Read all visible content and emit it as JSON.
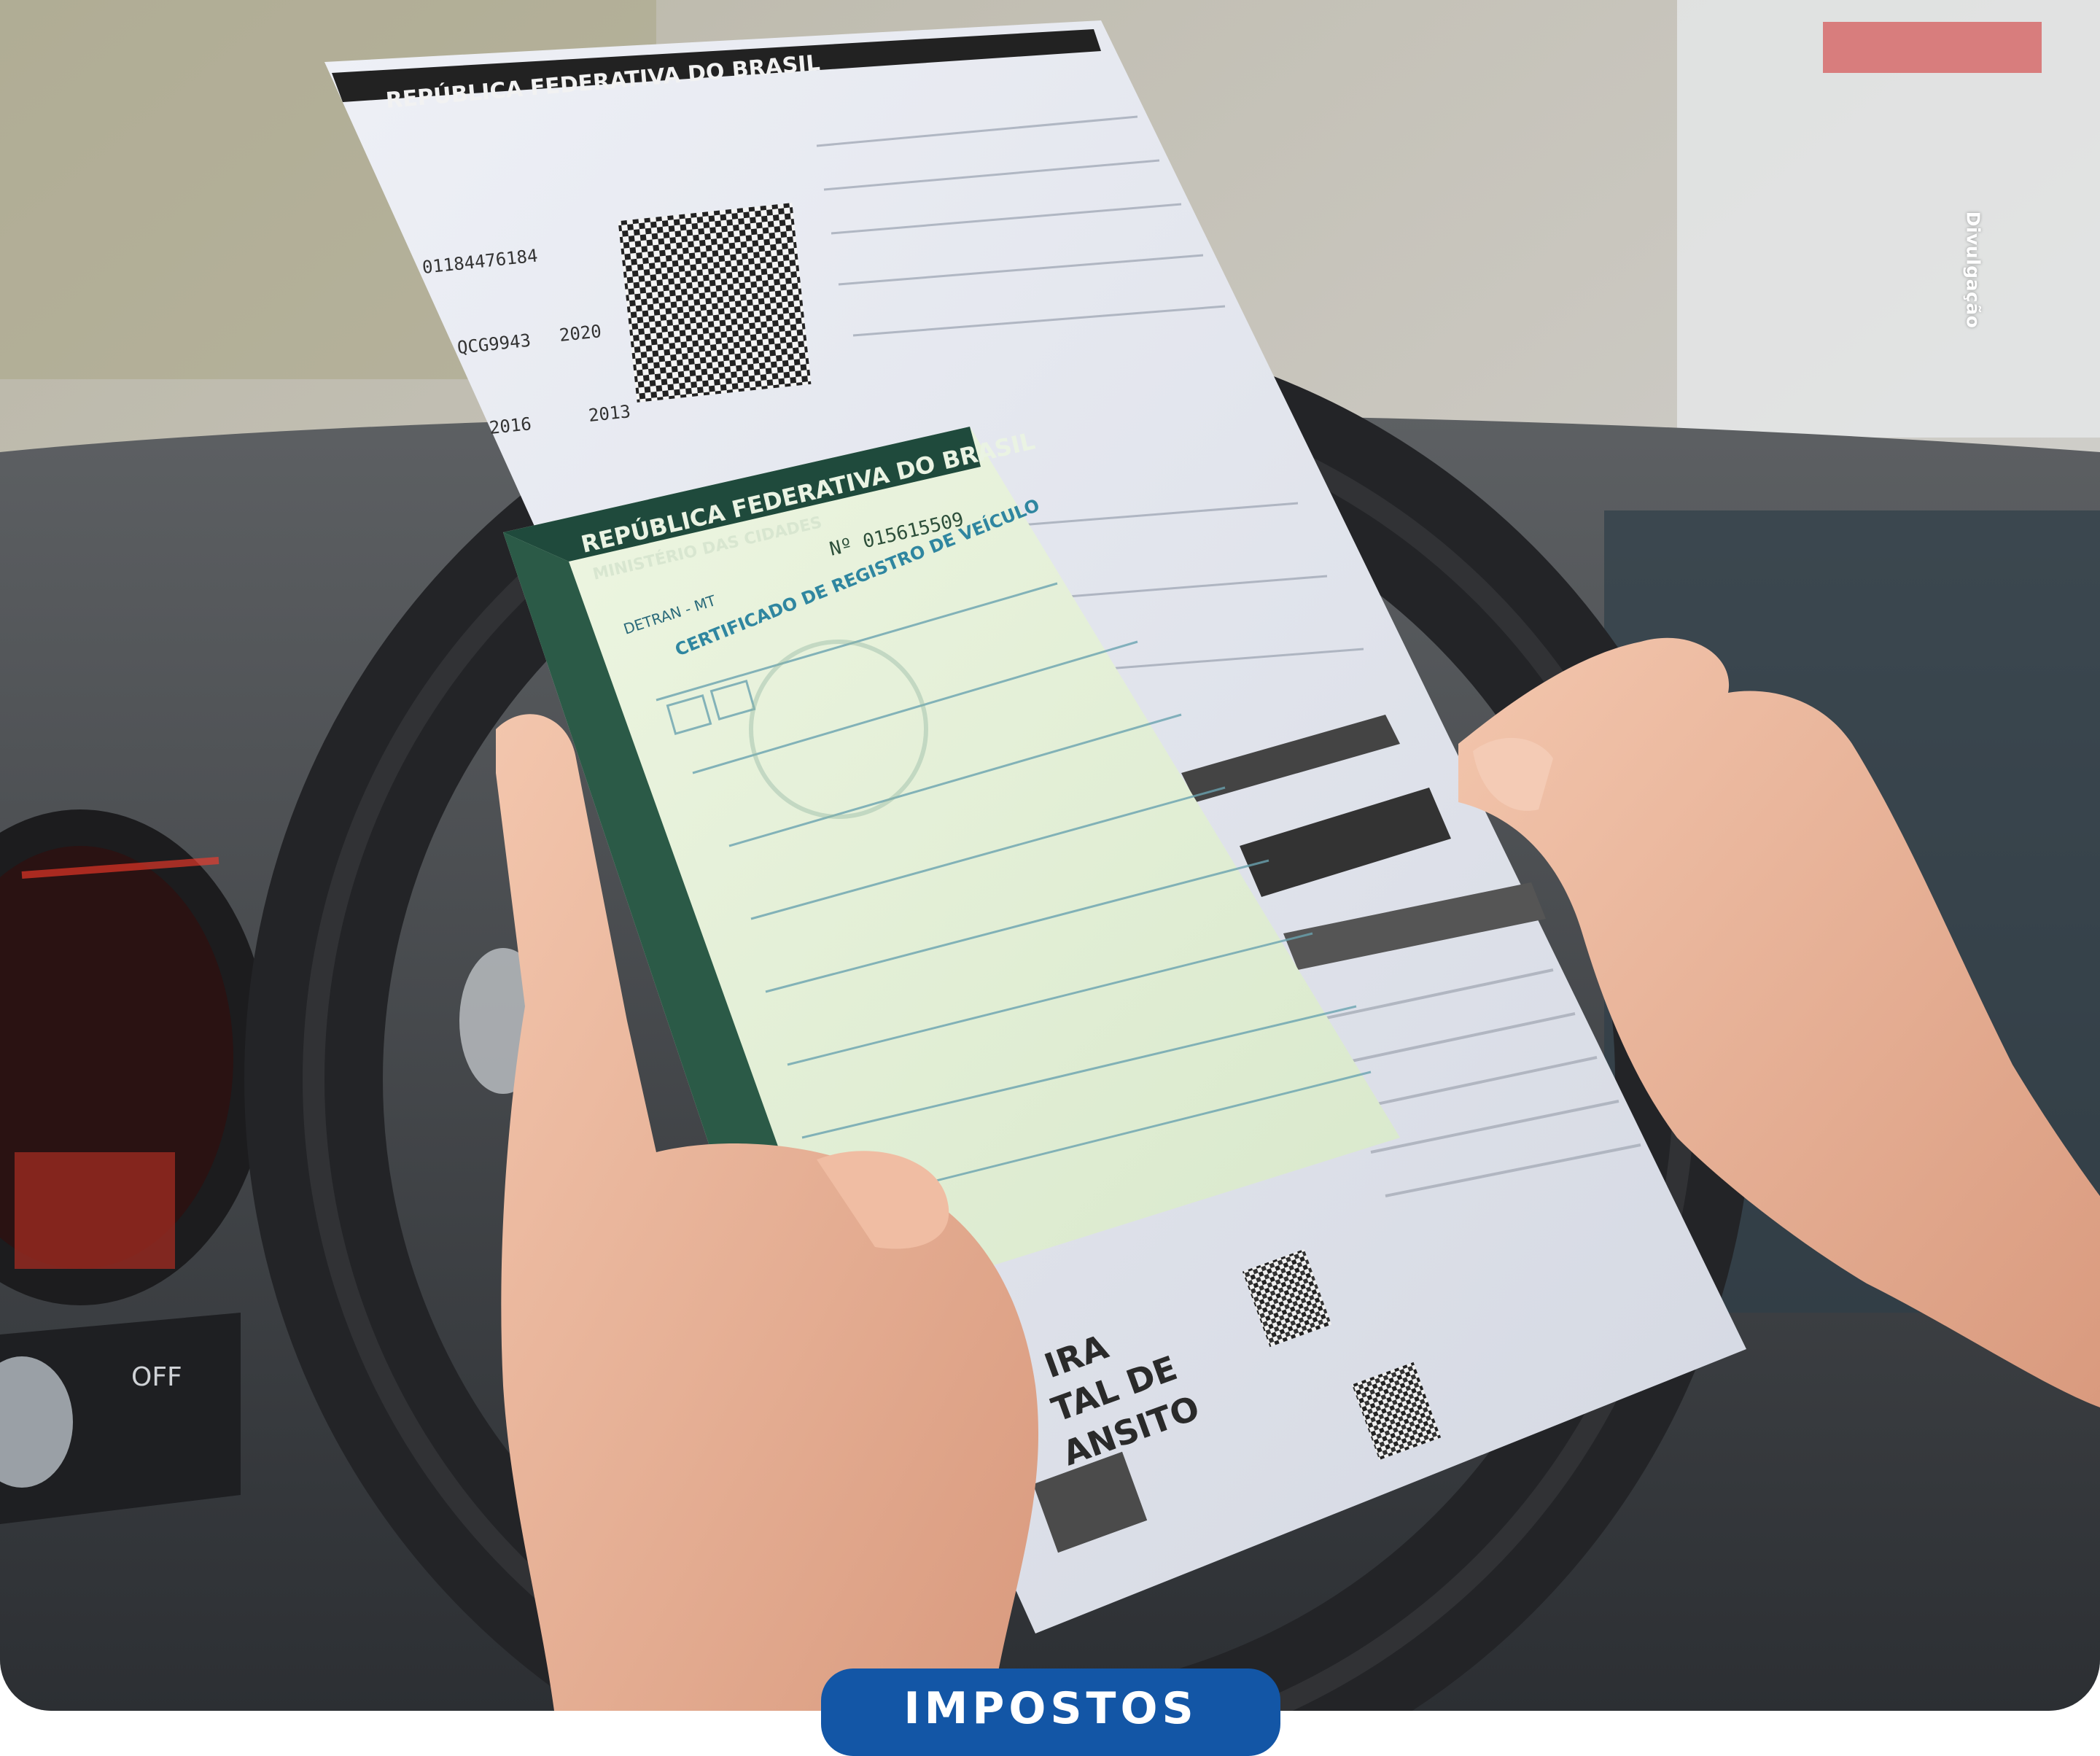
{
  "photo_credit": "Divulgação",
  "category_badge": "IMPOSTOS",
  "crlv_document": {
    "header": "REPÚBLICA FEDERATIVA DO BRASIL",
    "codigo_renavam": "01184476184",
    "placa": "QCG9943",
    "exercicio": "2020",
    "ano_fabricacao": "2016",
    "ano_modelo": "2013"
  },
  "crv_document": {
    "header": "REPÚBLICA FEDERATIVA DO BRASIL",
    "subheader": "MINISTÉRIO DAS CIDADES",
    "issuer": "DETRAN - MT",
    "number": "Nº 015615509",
    "title": "CERTIFICADO DE REGISTRO DE VEÍCULO"
  },
  "footer_ad": {
    "title_line1": "IRA",
    "title_line2": "TAL DE",
    "title_line3": "ANSITO"
  },
  "colors": {
    "badge": "#1356a6",
    "crv_paper": "#e4f0d6",
    "crv_border": "#1f4a3c",
    "crlv_paper": "#dfe3ee"
  }
}
